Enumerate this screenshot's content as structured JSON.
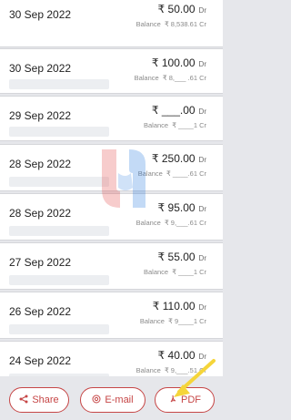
{
  "transactions": [
    {
      "date": "30 Sep 2022",
      "amount": "₹ 50.00",
      "type": "Dr",
      "balance_label": "Balance",
      "balance": "₹ 8,538.61 Cr"
    },
    {
      "date": "30 Sep 2022",
      "amount": "₹ 100.00",
      "type": "Dr",
      "balance_label": "Balance",
      "balance": "₹ 8,___ .61 Cr"
    },
    {
      "date": "29 Sep 2022",
      "amount": "₹ ___.00",
      "type": "Dr",
      "balance_label": "Balance",
      "balance": "₹ ____1 Cr"
    },
    {
      "date": "28 Sep 2022",
      "amount": "₹ 250.00",
      "type": "Dr",
      "balance_label": "Balance",
      "balance": "₹ ____.61 Cr"
    },
    {
      "date": "28 Sep 2022",
      "amount": "₹ 95.00",
      "type": "Dr",
      "balance_label": "Balance",
      "balance": "₹ 9,___.61 Cr"
    },
    {
      "date": "27 Sep 2022",
      "amount": "₹ 55.00",
      "type": "Dr",
      "balance_label": "Balance",
      "balance": "₹ ____1 Cr"
    },
    {
      "date": "26 Sep 2022",
      "amount": "₹ 110.00",
      "type": "Dr",
      "balance_label": "Balance",
      "balance": "₹ 9____1 Cr"
    },
    {
      "date": "24 Sep 2022",
      "amount": "₹ 40.00",
      "type": "Dr",
      "balance_label": "Balance",
      "balance": "₹ 9,___.51 Cr"
    }
  ],
  "actions": {
    "share": "Share",
    "email": "E-mail",
    "pdf": "PDF"
  },
  "icons": {
    "share": "share-icon",
    "email": "at-sign-icon",
    "pdf": "pdf-icon"
  },
  "colors": {
    "accent": "#c64646",
    "background": "#e6e7eb",
    "watermark_red": "#e54b4b",
    "watermark_blue": "#2d7de0"
  }
}
